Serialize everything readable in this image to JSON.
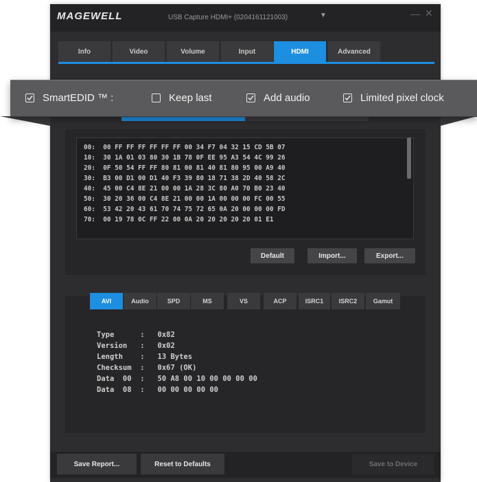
{
  "window": {
    "logo": "MAGEWELL",
    "device": "USB Capture HDMI+ (0204161121003)",
    "minimize": "—",
    "close": "✕"
  },
  "tabs": [
    {
      "label": "Info"
    },
    {
      "label": "Video"
    },
    {
      "label": "Volume"
    },
    {
      "label": "Input"
    },
    {
      "label": "HDMI"
    },
    {
      "label": "Advanced"
    }
  ],
  "active_tab": "HDMI",
  "options": {
    "smartedid": {
      "label": "SmartEDID ™ :",
      "checked": true
    },
    "keep_last": {
      "label": "Keep last",
      "checked": false
    },
    "add_audio": {
      "label": "Add audio",
      "checked": true
    },
    "limited_pixel_clock": {
      "label": "Limited pixel clock",
      "checked": true
    }
  },
  "edid": {
    "rows": [
      "00:  00 FF FF FF FF FF FF 00 34 F7 04 32 15 CD 5B 07",
      "10:  30 1A 01 03 80 30 1B 78 0F EE 95 A3 54 4C 99 26",
      "20:  0F 50 54 FF FF 80 81 00 81 40 81 80 95 00 A9 40",
      "30:  B3 00 D1 00 D1 40 F3 39 80 18 71 38 2D 40 58 2C",
      "40:  45 00 C4 8E 21 00 00 1A 28 3C 80 A0 70 B0 23 40",
      "50:  30 20 36 00 C4 8E 21 00 00 1A 00 00 00 FC 00 55",
      "60:  53 42 20 43 61 70 74 75 72 65 0A 20 00 00 00 FD",
      "70:  00 19 78 0C FF 22 00 0A 20 20 20 20 20 01 E1"
    ],
    "buttons": {
      "default": "Default",
      "import": "Import...",
      "export": "Export..."
    }
  },
  "infoframe_tabs": [
    {
      "label": "AVI"
    },
    {
      "label": "Audio"
    },
    {
      "label": "SPD"
    },
    {
      "label": "MS"
    },
    {
      "label": "VS"
    },
    {
      "label": "ACP"
    },
    {
      "label": "ISRC1"
    },
    {
      "label": "ISRC2"
    },
    {
      "label": "Gamut"
    }
  ],
  "active_infoframe_tab": "AVI",
  "infoframe": {
    "lines": [
      "Type      :   0x82",
      "Version   :   0x02",
      "Length    :   13 Bytes",
      "Checksum  :   0x67 (OK)",
      "Data  00  :   50 A8 00 10 00 00 00 00",
      "Data  08  :   00 00 00 00 00"
    ]
  },
  "footer": {
    "save_report": "Save Report...",
    "reset": "Reset to Defaults",
    "save_device": "Save to Device"
  },
  "colors": {
    "accent": "#1d8ee0",
    "background": "#2d2d2f"
  }
}
